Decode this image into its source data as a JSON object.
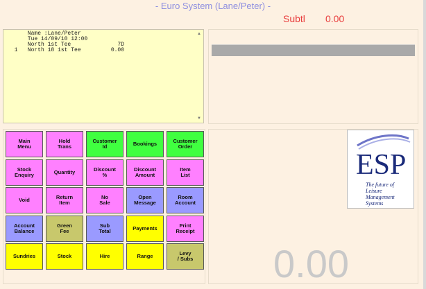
{
  "window": {
    "title": "- Euro System (Lane/Peter) -"
  },
  "header": {
    "subtotal_label": "Subtl",
    "subtotal_value": "0.00"
  },
  "receipt": {
    "lines": [
      "      Name :Lane/Peter",
      "      Tue 14/09/10 12:00",
      "      North 1st Tee              7D",
      "  1   North 18 1st Tee         0.00"
    ]
  },
  "keypad": {
    "colors": {
      "pink": "#ff80ff",
      "green": "#40ff40",
      "blue": "#9a9aff",
      "olive": "#c8c86c",
      "yellow": "#ffff00"
    },
    "rows": [
      [
        {
          "label": "Main\nMenu",
          "color": "pink"
        },
        {
          "label": "Hold\nTrans",
          "color": "pink"
        },
        {
          "label": "Customer\nId",
          "color": "green"
        },
        {
          "label": "Bookings",
          "color": "green"
        },
        {
          "label": "Customer\nOrder",
          "color": "green"
        }
      ],
      [
        {
          "label": "Stock\nEnquiry",
          "color": "pink"
        },
        {
          "label": "Quantity",
          "color": "pink"
        },
        {
          "label": "Discount\n%",
          "color": "pink"
        },
        {
          "label": "Discount\nAmount",
          "color": "pink"
        },
        {
          "label": "Item\nList",
          "color": "pink"
        }
      ],
      [
        {
          "label": "Void",
          "color": "pink"
        },
        {
          "label": "Return\nItem",
          "color": "pink"
        },
        {
          "label": "No\nSale",
          "color": "pink"
        },
        {
          "label": "Open\nMessage",
          "color": "blue"
        },
        {
          "label": "Room\nAccount",
          "color": "blue"
        }
      ],
      [
        {
          "label": "Account\nBalance",
          "color": "blue"
        },
        {
          "label": "Green\nFee",
          "color": "olive"
        },
        {
          "label": "Sub\nTotal",
          "color": "blue"
        },
        {
          "label": "Payments",
          "color": "yellow"
        },
        {
          "label": "Print\nReceipt",
          "color": "pink"
        }
      ],
      [
        {
          "label": "Sundries",
          "color": "yellow"
        },
        {
          "label": "Stock",
          "color": "yellow"
        },
        {
          "label": "Hire",
          "color": "yellow"
        },
        {
          "label": "Range",
          "color": "yellow"
        },
        {
          "label": "Levy\n/ Subs",
          "color": "olive"
        }
      ]
    ]
  },
  "logo": {
    "text": "ESP",
    "tagline": "The future of Leisure Management Systems"
  },
  "display": {
    "total": "0.00"
  },
  "icons": {
    "scroll_up": "scroll-up-arrow-icon",
    "scroll_down": "scroll-down-arrow-icon"
  }
}
